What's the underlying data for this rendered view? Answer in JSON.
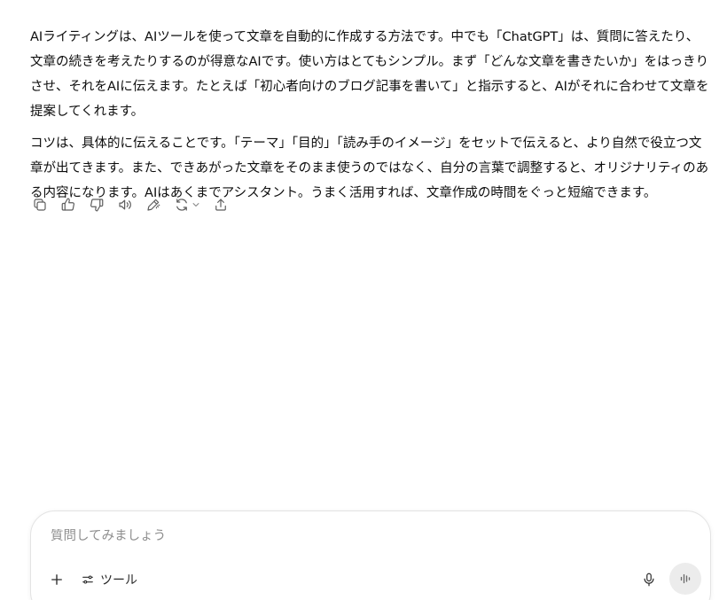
{
  "message": {
    "paragraphs": [
      "AIライティングは、AIツールを使って文章を自動的に作成する方法です。中でも「ChatGPT」は、質問に答えたり、文章の続きを考えたりするのが得意なAIです。使い方はとてもシンプル。まず「どんな文章を書きたいか」をはっきりさせ、それをAIに伝えます。たとえば「初心者向けのブログ記事を書いて」と指示すると、AIがそれに合わせて文章を提案してくれます。",
      "コツは、具体的に伝えることです。「テーマ」「目的」「読み手のイメージ」をセットで伝えると、より自然で役立つ文章が出てきます。また、できあがった文章をそのまま使うのではなく、自分の言葉で調整すると、オリジナリティのある内容になります。AIはあくまでアシスタント。うまく活用すれば、文章作成の時間をぐっと短縮できます。"
    ]
  },
  "actions": [
    {
      "name": "copy-icon"
    },
    {
      "name": "thumbs-up-icon"
    },
    {
      "name": "thumbs-down-icon"
    },
    {
      "name": "read-aloud-icon"
    },
    {
      "name": "edit-icon"
    },
    {
      "name": "regenerate-icon"
    },
    {
      "name": "share-icon"
    }
  ],
  "composer": {
    "placeholder": "質問してみましょう",
    "value": "",
    "tools_label": "ツール"
  },
  "colors": {
    "text": "#0d0d0d",
    "icon": "#5d5d5d",
    "placeholder": "#8f8f8f",
    "voice_button_bg": "#ececec"
  }
}
